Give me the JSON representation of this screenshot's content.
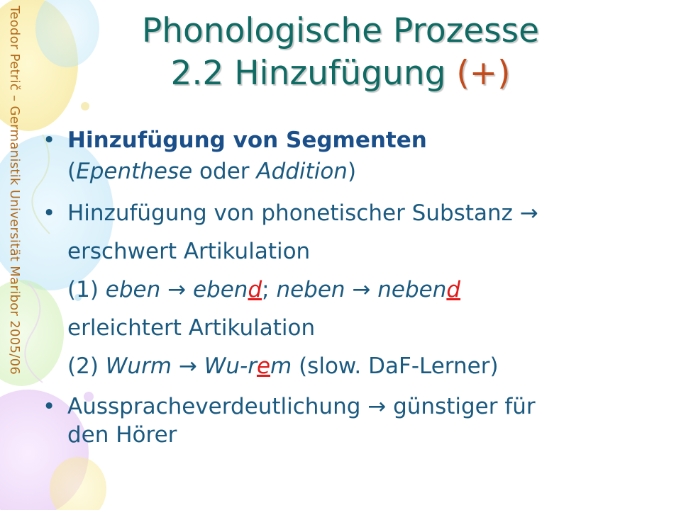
{
  "side_credit": "Teodor Petrič – Germanistik Universität Maribor 2005/06",
  "title": {
    "line1": "Phonologische Prozesse",
    "line2_main": "2.2 Hinzufügung ",
    "line2_accent": "(+)"
  },
  "bullet_symbol": "•",
  "arrow": "→",
  "bullets": [
    {
      "heading": "Hinzufügung von Segmenten",
      "paren_open": "(",
      "term1": "Epenthese",
      "connector": " oder ",
      "term2": "Addition",
      "paren_close": ")"
    },
    {
      "line1": "Hinzufügung von phonetischer Substanz ",
      "line2": "erschwert Artikulation",
      "ex1": {
        "num": "(1) ",
        "w1": "eben",
        "w2_base": "eben",
        "w2_added": "d",
        "sep": "; ",
        "w3": "neben",
        "w4_base": "neben",
        "w4_added": "d"
      },
      "line4": "erleichtert Artikulation",
      "ex2": {
        "num": "(2) ",
        "w1": "Wurm",
        "w2_pre": "Wu-r",
        "w2_added": "e",
        "w2_post": "m",
        "note": " (slow. DaF-Lerner)"
      }
    },
    {
      "line1_main": "Ausspracheverdeutlichung ",
      "line1_rest": " günstiger für",
      "line2": "den Hörer"
    }
  ]
}
